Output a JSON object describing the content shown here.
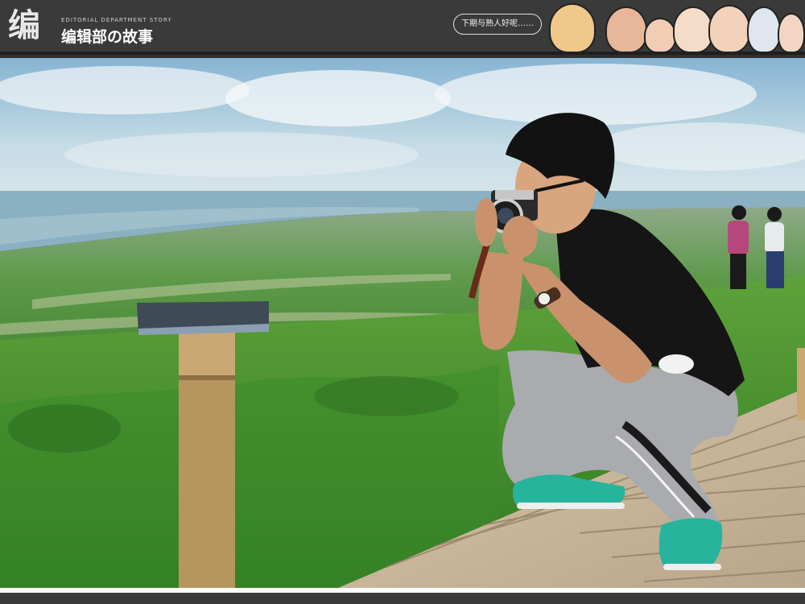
{
  "header": {
    "logo_mark": "编",
    "logo_sub": "EDITORIAL DEPARTMENT STORY",
    "logo_title": "编辑部の故事",
    "bubble_text": "下期与熟人好呢……"
  },
  "colors": {
    "header_bg": "#3a3a3a",
    "sky_top": "#9fc3d8",
    "sea": "#8fb4c4",
    "grass": "#4f9a35",
    "shirt": "#141414",
    "pants": "#a7a9ad",
    "shoes": "#2bb39b",
    "deck": "#cdbba0"
  },
  "icons": {
    "avatars": [
      "cartoon-face-icon",
      "cartoon-face-icon",
      "cartoon-face-icon",
      "cartoon-face-icon",
      "cartoon-face-icon",
      "cartoon-face-icon",
      "cartoon-face-icon"
    ]
  }
}
